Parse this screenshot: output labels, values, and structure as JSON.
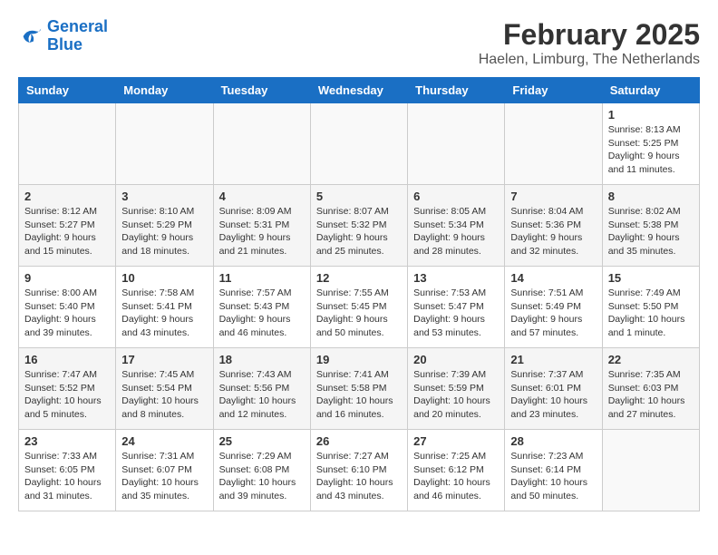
{
  "header": {
    "logo_line1": "General",
    "logo_line2": "Blue",
    "month": "February 2025",
    "location": "Haelen, Limburg, The Netherlands"
  },
  "weekdays": [
    "Sunday",
    "Monday",
    "Tuesday",
    "Wednesday",
    "Thursday",
    "Friday",
    "Saturday"
  ],
  "weeks": [
    [
      {
        "day": "",
        "info": ""
      },
      {
        "day": "",
        "info": ""
      },
      {
        "day": "",
        "info": ""
      },
      {
        "day": "",
        "info": ""
      },
      {
        "day": "",
        "info": ""
      },
      {
        "day": "",
        "info": ""
      },
      {
        "day": "1",
        "info": "Sunrise: 8:13 AM\nSunset: 5:25 PM\nDaylight: 9 hours and 11 minutes."
      }
    ],
    [
      {
        "day": "2",
        "info": "Sunrise: 8:12 AM\nSunset: 5:27 PM\nDaylight: 9 hours and 15 minutes."
      },
      {
        "day": "3",
        "info": "Sunrise: 8:10 AM\nSunset: 5:29 PM\nDaylight: 9 hours and 18 minutes."
      },
      {
        "day": "4",
        "info": "Sunrise: 8:09 AM\nSunset: 5:31 PM\nDaylight: 9 hours and 21 minutes."
      },
      {
        "day": "5",
        "info": "Sunrise: 8:07 AM\nSunset: 5:32 PM\nDaylight: 9 hours and 25 minutes."
      },
      {
        "day": "6",
        "info": "Sunrise: 8:05 AM\nSunset: 5:34 PM\nDaylight: 9 hours and 28 minutes."
      },
      {
        "day": "7",
        "info": "Sunrise: 8:04 AM\nSunset: 5:36 PM\nDaylight: 9 hours and 32 minutes."
      },
      {
        "day": "8",
        "info": "Sunrise: 8:02 AM\nSunset: 5:38 PM\nDaylight: 9 hours and 35 minutes."
      }
    ],
    [
      {
        "day": "9",
        "info": "Sunrise: 8:00 AM\nSunset: 5:40 PM\nDaylight: 9 hours and 39 minutes."
      },
      {
        "day": "10",
        "info": "Sunrise: 7:58 AM\nSunset: 5:41 PM\nDaylight: 9 hours and 43 minutes."
      },
      {
        "day": "11",
        "info": "Sunrise: 7:57 AM\nSunset: 5:43 PM\nDaylight: 9 hours and 46 minutes."
      },
      {
        "day": "12",
        "info": "Sunrise: 7:55 AM\nSunset: 5:45 PM\nDaylight: 9 hours and 50 minutes."
      },
      {
        "day": "13",
        "info": "Sunrise: 7:53 AM\nSunset: 5:47 PM\nDaylight: 9 hours and 53 minutes."
      },
      {
        "day": "14",
        "info": "Sunrise: 7:51 AM\nSunset: 5:49 PM\nDaylight: 9 hours and 57 minutes."
      },
      {
        "day": "15",
        "info": "Sunrise: 7:49 AM\nSunset: 5:50 PM\nDaylight: 10 hours and 1 minute."
      }
    ],
    [
      {
        "day": "16",
        "info": "Sunrise: 7:47 AM\nSunset: 5:52 PM\nDaylight: 10 hours and 5 minutes."
      },
      {
        "day": "17",
        "info": "Sunrise: 7:45 AM\nSunset: 5:54 PM\nDaylight: 10 hours and 8 minutes."
      },
      {
        "day": "18",
        "info": "Sunrise: 7:43 AM\nSunset: 5:56 PM\nDaylight: 10 hours and 12 minutes."
      },
      {
        "day": "19",
        "info": "Sunrise: 7:41 AM\nSunset: 5:58 PM\nDaylight: 10 hours and 16 minutes."
      },
      {
        "day": "20",
        "info": "Sunrise: 7:39 AM\nSunset: 5:59 PM\nDaylight: 10 hours and 20 minutes."
      },
      {
        "day": "21",
        "info": "Sunrise: 7:37 AM\nSunset: 6:01 PM\nDaylight: 10 hours and 23 minutes."
      },
      {
        "day": "22",
        "info": "Sunrise: 7:35 AM\nSunset: 6:03 PM\nDaylight: 10 hours and 27 minutes."
      }
    ],
    [
      {
        "day": "23",
        "info": "Sunrise: 7:33 AM\nSunset: 6:05 PM\nDaylight: 10 hours and 31 minutes."
      },
      {
        "day": "24",
        "info": "Sunrise: 7:31 AM\nSunset: 6:07 PM\nDaylight: 10 hours and 35 minutes."
      },
      {
        "day": "25",
        "info": "Sunrise: 7:29 AM\nSunset: 6:08 PM\nDaylight: 10 hours and 39 minutes."
      },
      {
        "day": "26",
        "info": "Sunrise: 7:27 AM\nSunset: 6:10 PM\nDaylight: 10 hours and 43 minutes."
      },
      {
        "day": "27",
        "info": "Sunrise: 7:25 AM\nSunset: 6:12 PM\nDaylight: 10 hours and 46 minutes."
      },
      {
        "day": "28",
        "info": "Sunrise: 7:23 AM\nSunset: 6:14 PM\nDaylight: 10 hours and 50 minutes."
      },
      {
        "day": "",
        "info": ""
      }
    ]
  ]
}
